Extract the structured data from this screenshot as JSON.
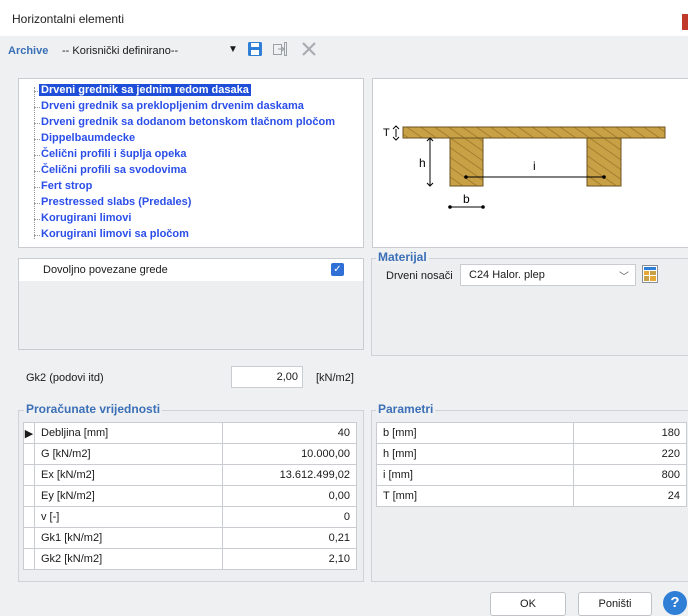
{
  "window": {
    "title": "Horizontalni elementi"
  },
  "toolbar": {
    "archive_label": "Archive",
    "archive_value": "-- Korisnički definirano--"
  },
  "tree": {
    "items": [
      "Drveni grednik sa jednim redom dasaka",
      "Drveni grednik sa preklopljenim drvenim daskama",
      "Drveni grednik sa dodanom betonskom tlačnom pločom",
      "Dippelbaumdecke",
      "Čelični profili i šuplja opeka",
      "Čelični profili sa svodovima",
      "Fert strop",
      "Prestressed slabs (Predales)",
      "Korugirani limovi",
      "Korugirani limovi sa pločom"
    ],
    "selected_index": 0
  },
  "diagram": {
    "label_T": "T",
    "label_h": "h",
    "label_i": "i",
    "label_b": "b"
  },
  "checkbox": {
    "label": "Dovoljno povezane grede",
    "checked": true
  },
  "material": {
    "group_title": "Materijal",
    "label": "Drveni nosači",
    "value": "C24 Halor. plep"
  },
  "gk2": {
    "label": "Gk2 (podovi itd)",
    "value": "2,00",
    "unit": "[kN/m2]"
  },
  "calc": {
    "group_title": "Proračunate vrijednosti",
    "rows": [
      {
        "name": "Debljina [mm]",
        "value": "40"
      },
      {
        "name": "G [kN/m2]",
        "value": "10.000,00"
      },
      {
        "name": "Ex [kN/m2]",
        "value": "13.612.499,02"
      },
      {
        "name": "Ey [kN/m2]",
        "value": "0,00"
      },
      {
        "name": "v  [-]",
        "value": "0"
      },
      {
        "name": "Gk1 [kN/m2]",
        "value": "0,21"
      },
      {
        "name": "Gk2 [kN/m2]",
        "value": "2,10"
      }
    ]
  },
  "params": {
    "group_title": "Parametri",
    "rows": [
      {
        "name": "b [mm]",
        "value": "180"
      },
      {
        "name": "h [mm]",
        "value": "220"
      },
      {
        "name": "i [mm]",
        "value": "800"
      },
      {
        "name": "T [mm]",
        "value": "24"
      }
    ]
  },
  "buttons": {
    "ok": "OK",
    "cancel": "Poništi",
    "help": "?"
  },
  "colors": {
    "accent": "#2f6fd6",
    "wood": "#c8a046",
    "link": "#2a4ee8"
  }
}
